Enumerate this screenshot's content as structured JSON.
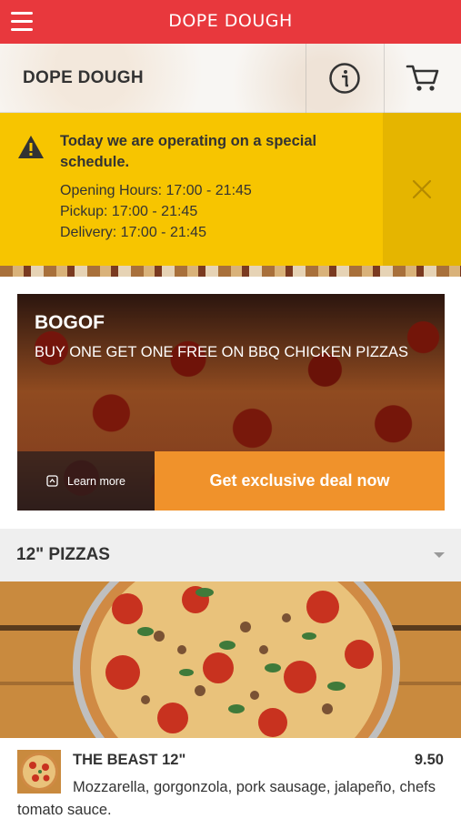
{
  "topbar": {
    "title": "DOPE DOUGH"
  },
  "header": {
    "brand": "DOPE DOUGH"
  },
  "notice": {
    "title": "Today we are operating on a special schedule.",
    "lines": [
      "Opening Hours: 17:00 - 21:45",
      "Pickup: 17:00 - 21:45",
      "Delivery: 17:00 - 21:45"
    ]
  },
  "promo": {
    "title": "BOGOF",
    "subtitle": "BUY ONE GET ONE FREE ON BBQ CHICKEN PIZZAS",
    "learn_more": "Learn more",
    "deal_button": "Get exclusive deal now"
  },
  "menu_section": {
    "title": "12\" PIZZAS"
  },
  "items": [
    {
      "name": "THE BEAST 12\"",
      "price": "9.50",
      "description": "Mozzarella, gorgonzola, pork sausage, jalapeño, chefs tomato sauce."
    }
  ],
  "colors": {
    "brand_red": "#e8383d",
    "notice_yellow": "#f7c500",
    "deal_orange": "#f0922b"
  },
  "icons": [
    "menu-icon",
    "info-icon",
    "cart-icon",
    "warning-icon",
    "close-icon",
    "learn-more-icon",
    "chevron-down-icon"
  ]
}
